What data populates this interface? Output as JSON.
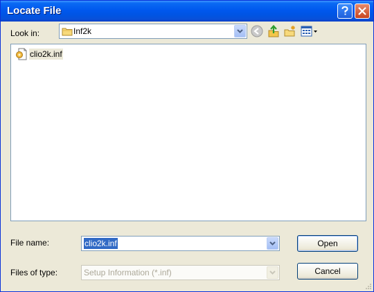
{
  "window": {
    "title": "Locate File"
  },
  "lookin": {
    "label": "Look in:",
    "value": "Inf2k"
  },
  "toolbar": {
    "icons": [
      "back-icon",
      "up-folder-icon",
      "new-folder-icon",
      "view-menu-icon"
    ]
  },
  "files": [
    {
      "name": "clio2k.inf",
      "icon": "setup-info-file-icon"
    }
  ],
  "filename": {
    "label": "File name:",
    "value": "clio2k.inf"
  },
  "filetype": {
    "label": "Files of type:",
    "value": "Setup Information (*.inf)"
  },
  "buttons": {
    "open": "Open",
    "cancel": "Cancel"
  },
  "colors": {
    "titlebar": "#0054e3",
    "selection": "#316ac5",
    "dialog": "#ece9d8"
  }
}
